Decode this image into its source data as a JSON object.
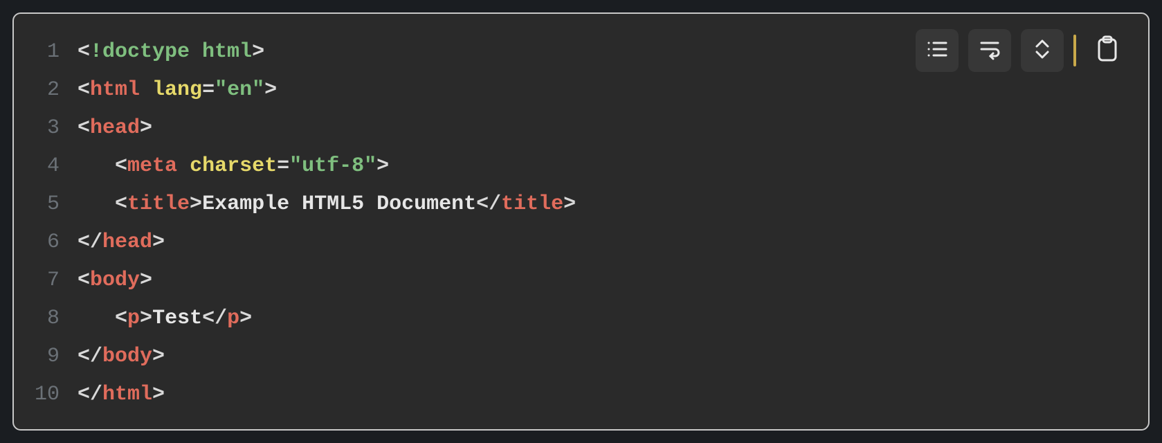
{
  "toolbar": {
    "list_btn": "line-numbers",
    "wrap_btn": "word-wrap",
    "expand_btn": "expand",
    "copy_btn": "copy"
  },
  "code": {
    "lines": [
      {
        "n": "1",
        "indent": "",
        "tokens": [
          {
            "c": "tok-bracket",
            "t": "<"
          },
          {
            "c": "tok-doctype",
            "t": "!doctype html"
          },
          {
            "c": "tok-bracket",
            "t": ">"
          }
        ]
      },
      {
        "n": "2",
        "indent": "",
        "tokens": [
          {
            "c": "tok-bracket",
            "t": "<"
          },
          {
            "c": "tok-tag",
            "t": "html"
          },
          {
            "c": "tok-text",
            "t": " "
          },
          {
            "c": "tok-attr",
            "t": "lang"
          },
          {
            "c": "tok-eq",
            "t": "="
          },
          {
            "c": "tok-str",
            "t": "\"en\""
          },
          {
            "c": "tok-bracket",
            "t": ">"
          }
        ]
      },
      {
        "n": "3",
        "indent": "",
        "tokens": [
          {
            "c": "tok-bracket",
            "t": "<"
          },
          {
            "c": "tok-tag",
            "t": "head"
          },
          {
            "c": "tok-bracket",
            "t": ">"
          }
        ]
      },
      {
        "n": "4",
        "indent": "   ",
        "tokens": [
          {
            "c": "tok-bracket",
            "t": "<"
          },
          {
            "c": "tok-tag",
            "t": "meta"
          },
          {
            "c": "tok-text",
            "t": " "
          },
          {
            "c": "tok-attr",
            "t": "charset"
          },
          {
            "c": "tok-eq",
            "t": "="
          },
          {
            "c": "tok-str",
            "t": "\"utf-8\""
          },
          {
            "c": "tok-bracket",
            "t": ">"
          }
        ]
      },
      {
        "n": "5",
        "indent": "   ",
        "tokens": [
          {
            "c": "tok-bracket",
            "t": "<"
          },
          {
            "c": "tok-tag",
            "t": "title"
          },
          {
            "c": "tok-bracket",
            "t": ">"
          },
          {
            "c": "tok-text",
            "t": "Example HTML5 Document"
          },
          {
            "c": "tok-bracket",
            "t": "</"
          },
          {
            "c": "tok-tag",
            "t": "title"
          },
          {
            "c": "tok-bracket",
            "t": ">"
          }
        ]
      },
      {
        "n": "6",
        "indent": "",
        "tokens": [
          {
            "c": "tok-bracket",
            "t": "</"
          },
          {
            "c": "tok-tag",
            "t": "head"
          },
          {
            "c": "tok-bracket",
            "t": ">"
          }
        ]
      },
      {
        "n": "7",
        "indent": "",
        "tokens": [
          {
            "c": "tok-bracket",
            "t": "<"
          },
          {
            "c": "tok-tag",
            "t": "body"
          },
          {
            "c": "tok-bracket",
            "t": ">"
          }
        ]
      },
      {
        "n": "8",
        "indent": "   ",
        "tokens": [
          {
            "c": "tok-bracket",
            "t": "<"
          },
          {
            "c": "tok-tag",
            "t": "p"
          },
          {
            "c": "tok-bracket",
            "t": ">"
          },
          {
            "c": "tok-text",
            "t": "Test"
          },
          {
            "c": "tok-bracket",
            "t": "</"
          },
          {
            "c": "tok-tag",
            "t": "p"
          },
          {
            "c": "tok-bracket",
            "t": ">"
          }
        ]
      },
      {
        "n": "9",
        "indent": "",
        "tokens": [
          {
            "c": "tok-bracket",
            "t": "</"
          },
          {
            "c": "tok-tag",
            "t": "body"
          },
          {
            "c": "tok-bracket",
            "t": ">"
          }
        ]
      },
      {
        "n": "10",
        "indent": "",
        "tokens": [
          {
            "c": "tok-bracket",
            "t": "</"
          },
          {
            "c": "tok-tag",
            "t": "html"
          },
          {
            "c": "tok-bracket",
            "t": ">"
          }
        ]
      }
    ]
  }
}
